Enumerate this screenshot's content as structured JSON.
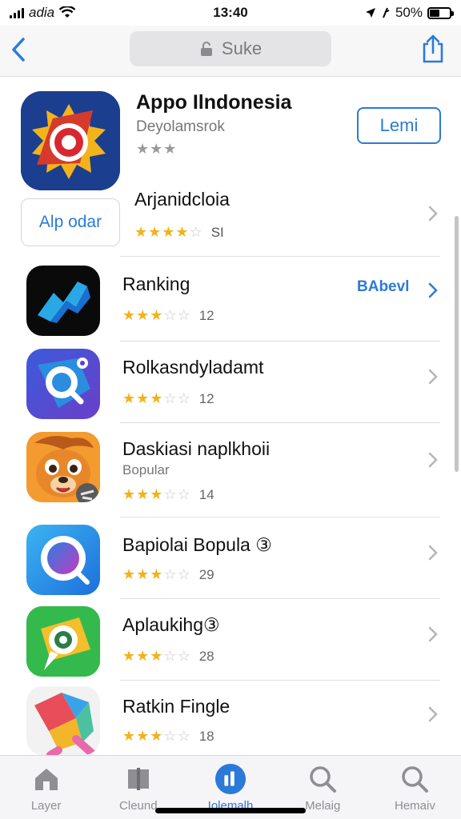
{
  "status_bar": {
    "carrier": "adia",
    "time": "13:40",
    "battery": "50%",
    "battery_fraction": 0.5
  },
  "nav": {
    "search_text": "Suke",
    "icons": {
      "back": "chevron-left-icon",
      "lock": "lock-icon",
      "share": "share-icon"
    }
  },
  "featured": {
    "title": "Appo Ilndonesia",
    "subtitle": "Deyolamsrok",
    "stars": "★★★",
    "get_button": "Lemi",
    "label_button": "Alp odar",
    "name2": "Arjanidcloia",
    "rating": {
      "filled": 4,
      "total": 5,
      "count": "SI"
    }
  },
  "apps": [
    {
      "name": "Ranking",
      "rating": {
        "filled": 3,
        "total": 5,
        "count": "12"
      },
      "action": "BAbevl"
    },
    {
      "name": "Rolkasndyladamt",
      "rating": {
        "filled": 3,
        "total": 5,
        "count": "12"
      }
    },
    {
      "name": "Daskiasi naplkhoii",
      "subtitle": "Bopular",
      "rating": {
        "filled": 3,
        "total": 5,
        "count": "14"
      }
    },
    {
      "name": "Bapiolai Bopula ③",
      "rating": {
        "filled": 3,
        "total": 5,
        "count": "29"
      }
    },
    {
      "name": "Aplaukihg③",
      "rating": {
        "filled": 3,
        "total": 5,
        "count": "28"
      }
    },
    {
      "name": "Ratkin Fingle",
      "rating": {
        "filled": 3,
        "total": 5,
        "count": "18"
      }
    }
  ],
  "tabs": [
    {
      "label": "Layer",
      "icon": "home-icon"
    },
    {
      "label": "Cleund",
      "icon": "book-icon"
    },
    {
      "label": "Iolemalh",
      "icon": "chart-icon",
      "active": true
    },
    {
      "label": "Melaig",
      "icon": "search-icon"
    },
    {
      "label": "Hemaiv",
      "icon": "search-icon"
    }
  ],
  "colors": {
    "accent": "#2c7ad8",
    "star": "#f2b21b"
  }
}
